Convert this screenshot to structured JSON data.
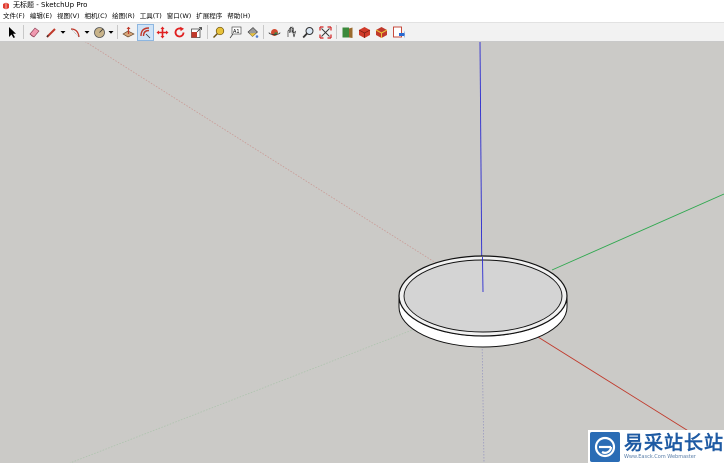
{
  "window": {
    "title": "无标题 - SketchUp Pro"
  },
  "menu": {
    "items": [
      {
        "label": "文件(F)"
      },
      {
        "label": "编辑(E)"
      },
      {
        "label": "视图(V)"
      },
      {
        "label": "相机(C)"
      },
      {
        "label": "绘图(R)"
      },
      {
        "label": "工具(T)"
      },
      {
        "label": "窗口(W)"
      },
      {
        "label": "扩展程序"
      },
      {
        "label": "帮助(H)"
      }
    ]
  },
  "toolbar": {
    "tools": [
      "select-tool-icon",
      "eraser-tool-icon",
      "pencil-line-tool-icon",
      "arc-tool-icon",
      "shapes-tool-icon",
      "push-pull-tool-icon",
      "offset-tool-icon",
      "move-tool-icon",
      "rotate-tool-icon",
      "scale-tool-icon",
      "tape-measure-tool-icon",
      "text-tool-icon",
      "paint-bucket-tool-icon",
      "orbit-tool-icon",
      "pan-tool-icon",
      "zoom-tool-icon",
      "zoom-extents-tool-icon",
      "3d-warehouse-icon",
      "extension-warehouse-icon",
      "layout-send-icon",
      "extension-manager-icon"
    ],
    "active_tool": "offset-tool-icon"
  },
  "viewport": {
    "background": "#cbcac7",
    "axis_colors": {
      "red": "#c0392b",
      "green": "#2fa84f",
      "blue": "#2b2bd0"
    }
  },
  "watermark": {
    "title": "易采站长站",
    "subtitle": "Www.Easck.Com Webmaster"
  }
}
